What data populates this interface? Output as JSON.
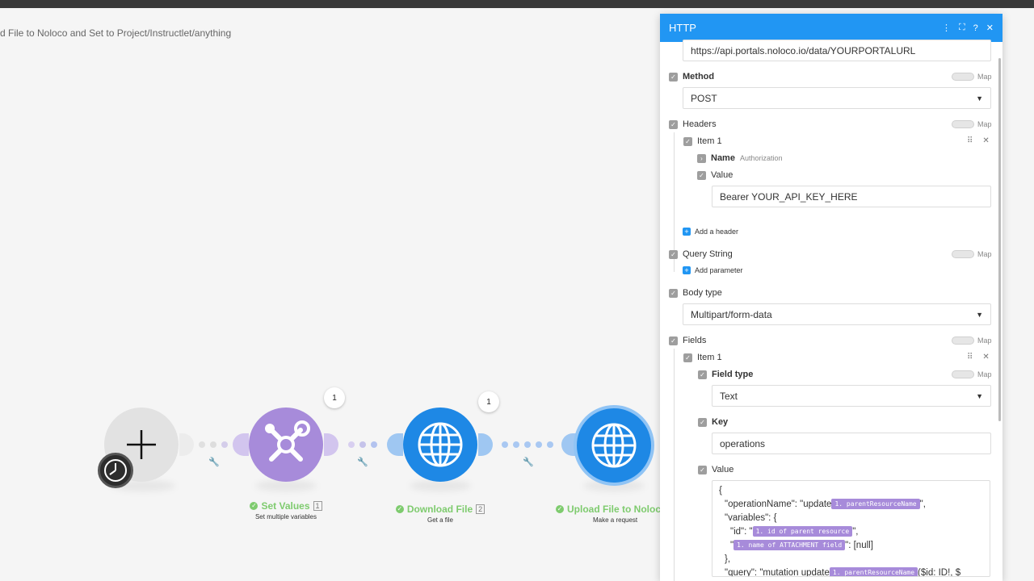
{
  "scenario": {
    "title": "d File to Noloco and Set to Project/Instructlet/anything"
  },
  "canvas": {
    "modules": [
      {
        "name": "",
        "subtitle": "",
        "badge": ""
      },
      {
        "name": "Set Values",
        "num": "1",
        "subtitle": "Set multiple variables",
        "badge": "1"
      },
      {
        "name": "Download File",
        "num": "2",
        "subtitle": "Get a file",
        "badge": "1"
      },
      {
        "name": "Upload File to Noloco",
        "num": "",
        "subtitle": "Make a request",
        "badge": ""
      }
    ],
    "icons": {
      "trigger": "plus-icon",
      "tools": "tools-icon",
      "http": "globe-icon",
      "clock": "clock-icon"
    },
    "colors": {
      "tools": "#a78bda",
      "http": "#1e88e5",
      "success": "#7ecb6e"
    }
  },
  "panel": {
    "title": "HTTP",
    "header_color": "#2196f3",
    "url_value": "https://api.portals.noloco.io/data/YOURPORTALURL",
    "map_label": "Map",
    "method": {
      "label": "Method",
      "value": "POST"
    },
    "headers": {
      "label": "Headers",
      "item_label": "Item 1",
      "name_label": "Name",
      "name_hint": "Authorization",
      "value_label": "Value",
      "value": "Bearer YOUR_API_KEY_HERE",
      "add_label": "Add a header"
    },
    "query": {
      "label": "Query String",
      "add_label": "Add parameter"
    },
    "body_type": {
      "label": "Body type",
      "value": "Multipart/form-data"
    },
    "fields": {
      "label": "Fields",
      "item_label": "Item 1",
      "field_type_label": "Field type",
      "field_type_value": "Text",
      "key_label": "Key",
      "key_value": "operations",
      "value_label": "Value",
      "code": {
        "l1": "{",
        "l2a": "\"operationName\": \"update",
        "l2pill": "1. parentResourceName",
        "l2b": "\",",
        "l3": "\"variables\": {",
        "l4a": "\"id\": \"",
        "l4pill": "1. id of parent resource",
        "l4b": "\",",
        "l5a": "\"",
        "l5pill": "1. name of ATTACHMENT field",
        "l5b": "\": [null]",
        "l6": "},",
        "l7a": "\"query\": \"mutation update",
        "l7pill": "1. parentResourceName",
        "l7b": "($id: ID!, $"
      }
    }
  }
}
